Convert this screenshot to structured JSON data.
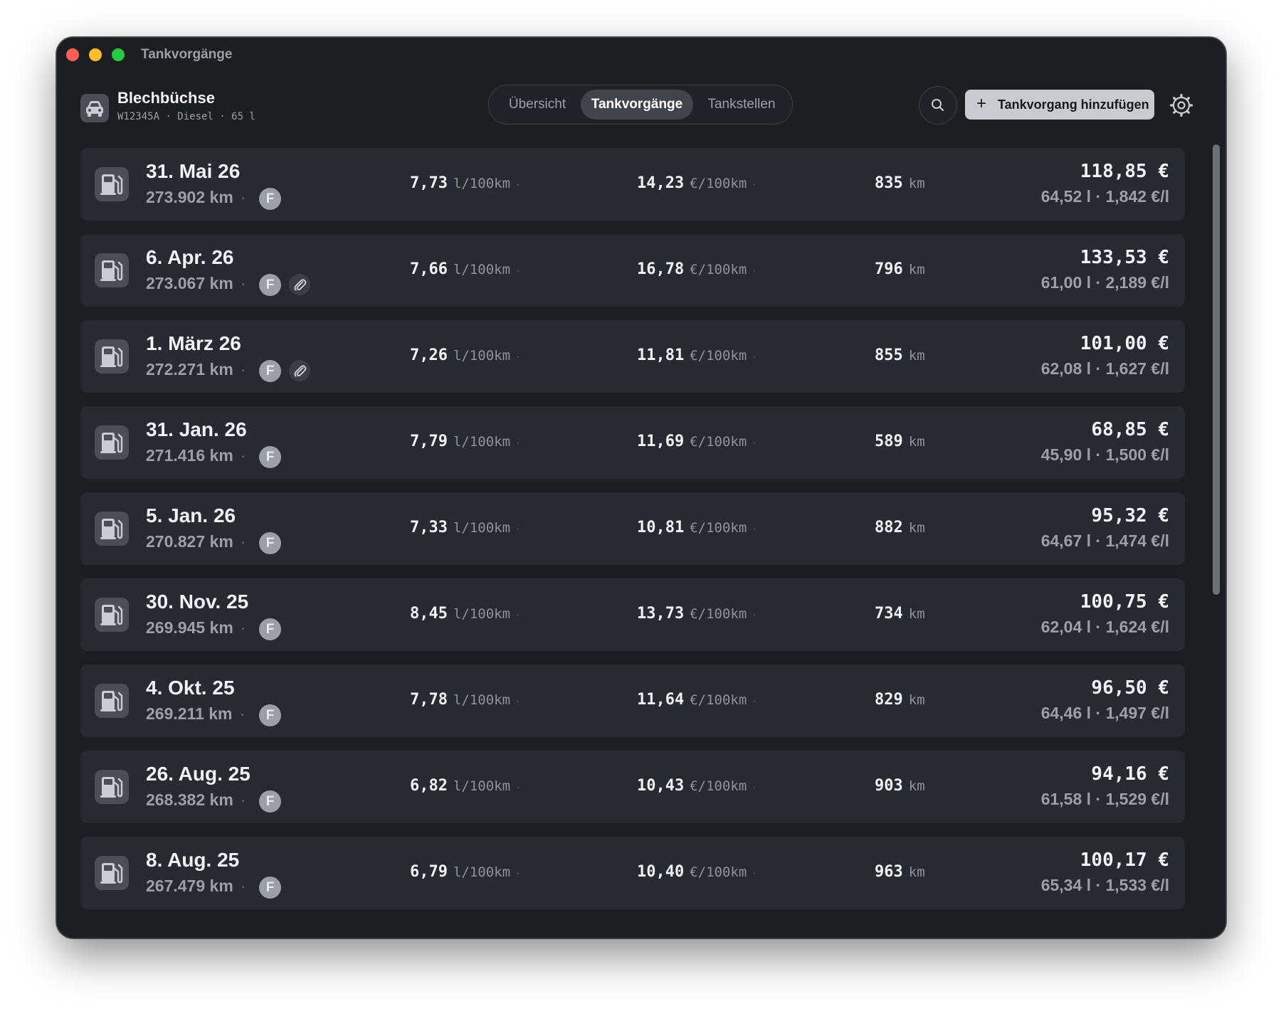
{
  "window": {
    "title": "Tankvorgänge"
  },
  "vehicle": {
    "name": "Blechbüchse",
    "details": "W12345A · Diesel · 65 l",
    "icon": "car-icon"
  },
  "tabs": [
    {
      "label": "Übersicht",
      "selected": false
    },
    {
      "label": "Tankvorgänge",
      "selected": true
    },
    {
      "label": "Tankstellen",
      "selected": false
    }
  ],
  "toolbar": {
    "search_icon": "search-icon",
    "add_icon": "+",
    "add_label": "Tankvorgang hinzufügen",
    "settings_icon": "gear-icon"
  },
  "units": {
    "consumption": "l/100km",
    "cost": "€/100km",
    "distance": "km"
  },
  "separator": "·",
  "badge_label": "F",
  "refuelings": [
    {
      "date": "31. Mai 26",
      "odometer": "273.902 km",
      "attachment": false,
      "consumption": "7,73",
      "cost_per_100km": "14,23",
      "distance": "835",
      "price": "118,85 €",
      "detail": "64,52 l · 1,842 €/l"
    },
    {
      "date": "6. Apr. 26",
      "odometer": "273.067 km",
      "attachment": true,
      "consumption": "7,66",
      "cost_per_100km": "16,78",
      "distance": "796",
      "price": "133,53 €",
      "detail": "61,00 l · 2,189 €/l"
    },
    {
      "date": "1. März 26",
      "odometer": "272.271 km",
      "attachment": true,
      "consumption": "7,26",
      "cost_per_100km": "11,81",
      "distance": "855",
      "price": "101,00 €",
      "detail": "62,08 l · 1,627 €/l"
    },
    {
      "date": "31. Jan. 26",
      "odometer": "271.416 km",
      "attachment": false,
      "consumption": "7,79",
      "cost_per_100km": "11,69",
      "distance": "589",
      "price": "68,85 €",
      "detail": "45,90 l · 1,500 €/l"
    },
    {
      "date": "5. Jan. 26",
      "odometer": "270.827 km",
      "attachment": false,
      "consumption": "7,33",
      "cost_per_100km": "10,81",
      "distance": "882",
      "price": "95,32 €",
      "detail": "64,67 l · 1,474 €/l"
    },
    {
      "date": "30. Nov. 25",
      "odometer": "269.945 km",
      "attachment": false,
      "consumption": "8,45",
      "cost_per_100km": "13,73",
      "distance": "734",
      "price": "100,75 €",
      "detail": "62,04 l · 1,624 €/l"
    },
    {
      "date": "4. Okt. 25",
      "odometer": "269.211 km",
      "attachment": false,
      "consumption": "7,78",
      "cost_per_100km": "11,64",
      "distance": "829",
      "price": "96,50 €",
      "detail": "64,46 l · 1,497 €/l"
    },
    {
      "date": "26. Aug. 25",
      "odometer": "268.382 km",
      "attachment": false,
      "consumption": "6,82",
      "cost_per_100km": "10,43",
      "distance": "903",
      "price": "94,16 €",
      "detail": "61,58 l · 1,529 €/l"
    },
    {
      "date": "8. Aug. 25",
      "odometer": "267.479 km",
      "attachment": false,
      "consumption": "6,79",
      "cost_per_100km": "10,40",
      "distance": "963",
      "price": "100,17 €",
      "detail": "65,34 l · 1,533 €/l"
    }
  ],
  "colors": {
    "window_bg": "#1b1e23",
    "row_bg": "#262b33",
    "primary_button": "#c7ccd3",
    "selected_tab": "#40444c",
    "close": "#ff5f57",
    "minimize": "#febc2e",
    "zoom": "#28c840"
  }
}
